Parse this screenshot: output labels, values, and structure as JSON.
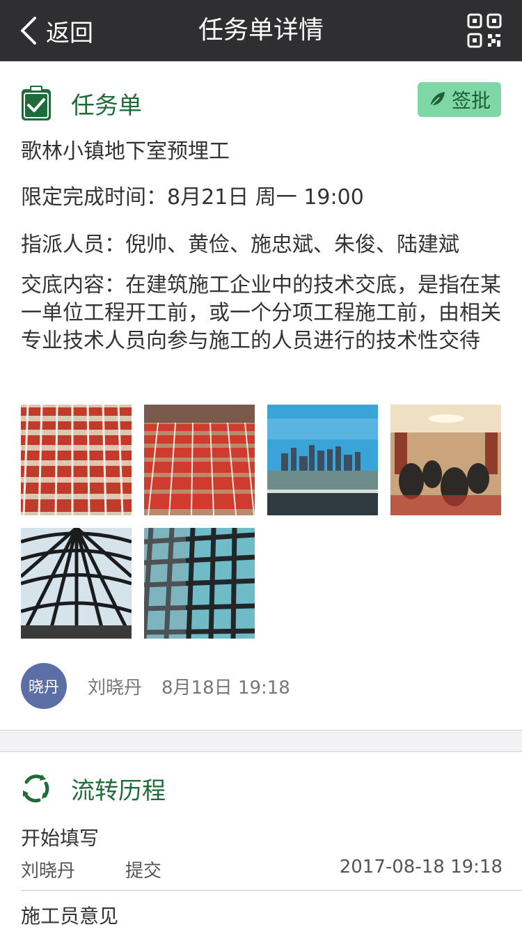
{
  "nav": {
    "back_label": "返回",
    "title": "任务单详情"
  },
  "task": {
    "section_title": "任务单",
    "sign_label": "签批",
    "name": "歌林小镇地下室预埋工",
    "deadline": "限定完成时间：8月21日  周一  19:00",
    "assignees": "指派人员：倪帅、黄俭、施忠斌、朱俊、陆建斌",
    "description": "交底内容：在建筑施工企业中的技术交底，是指在某一单位工程开工前，或一个分项工程施工前，由相关专业技术人员向参与施工的人员进行的技术性交待",
    "images": [
      "red-bags-rows-photo",
      "red-bags-hall-photo",
      "river-skyline-photo",
      "banquet-room-photo",
      "glass-dome-photo",
      "glass-facade-photo"
    ],
    "author": {
      "avatar_text": "晓丹",
      "name": "刘晓丹",
      "time": "8月18日 19:18"
    }
  },
  "flow": {
    "section_title": "流转历程",
    "steps": [
      {
        "title": "开始填写",
        "user": "刘晓丹",
        "action": "提交",
        "time": "2017-08-18  19:18"
      },
      {
        "title": "施工员意见"
      }
    ]
  },
  "colors": {
    "nav_bg": "#2f2f31",
    "accent_green": "#1f6b3a",
    "sign_bg": "#7fd6a6",
    "avatar_bg": "#5c6ea6"
  }
}
